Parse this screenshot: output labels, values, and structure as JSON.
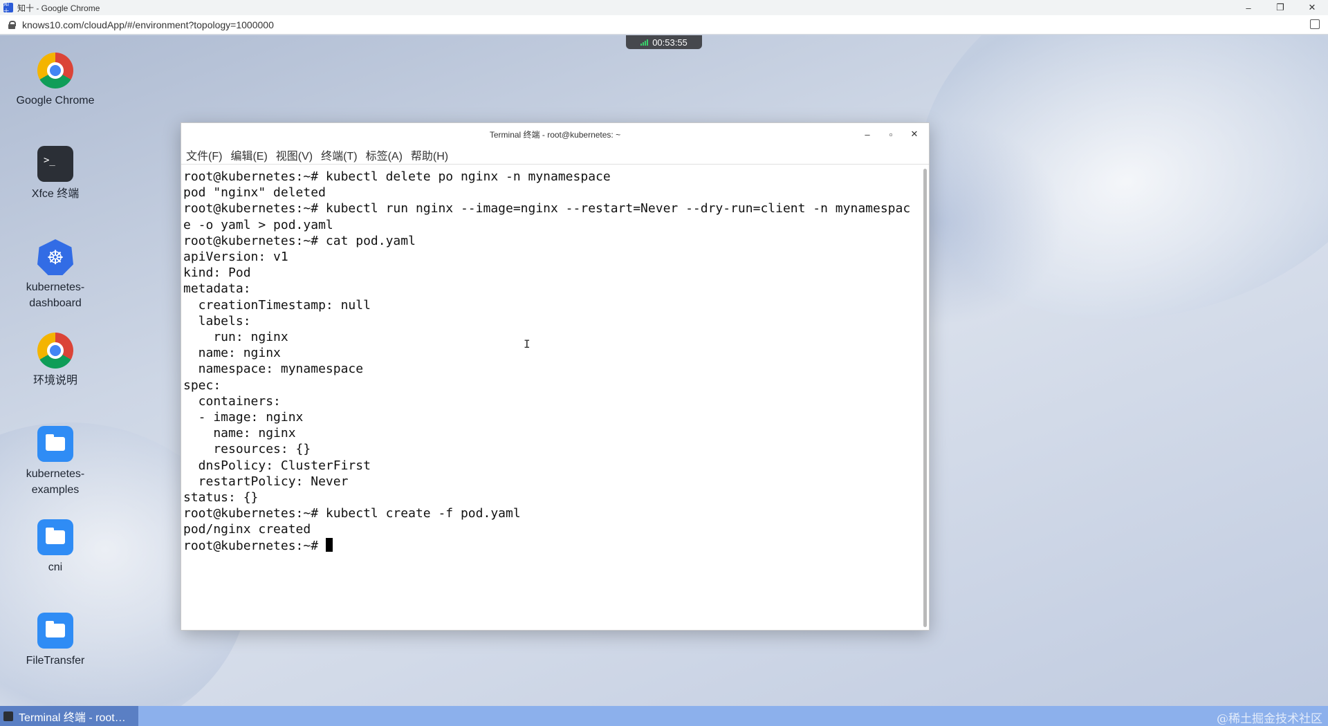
{
  "chrome": {
    "window_title": "知十 - Google Chrome",
    "app_icon": "知十",
    "url": "knows10.com/cloudApp/#/environment?topology=1000000",
    "controls": {
      "minimize": "–",
      "maximize": "❐",
      "close": "✕"
    }
  },
  "desktop": {
    "timer": "00:53:55",
    "icons": [
      {
        "label": "Google Chrome",
        "icon": "chrome-icon"
      },
      {
        "label": "Xfce 终端",
        "icon": "terminal-icon"
      },
      {
        "label": "kubernetes-\ndashboard",
        "icon": "kubernetes-icon"
      },
      {
        "label": "环境说明",
        "icon": "chrome-icon"
      },
      {
        "label": "kubernetes-\nexamples",
        "icon": "folder-icon"
      },
      {
        "label": "cni",
        "icon": "folder-icon"
      },
      {
        "label": "FileTransfer",
        "icon": "folder-icon"
      }
    ]
  },
  "terminal": {
    "title": "Terminal 终端 - root@kubernetes: ~",
    "controls": {
      "minimize": "–",
      "maximize": "▫",
      "close": "✕"
    },
    "menu": [
      "文件(F)",
      "编辑(E)",
      "视图(V)",
      "终端(T)",
      "标签(A)",
      "帮助(H)"
    ],
    "lines": [
      "root@kubernetes:~# kubectl delete po nginx -n mynamespace",
      "pod \"nginx\" deleted",
      "root@kubernetes:~# kubectl run nginx --image=nginx --restart=Never --dry-run=client -n mynamespac",
      "e -o yaml > pod.yaml",
      "root@kubernetes:~# cat pod.yaml",
      "apiVersion: v1",
      "kind: Pod",
      "metadata:",
      "  creationTimestamp: null",
      "  labels:",
      "    run: nginx",
      "  name: nginx",
      "  namespace: mynamespace",
      "spec:",
      "  containers:",
      "  - image: nginx",
      "    name: nginx",
      "    resources: {}",
      "  dnsPolicy: ClusterFirst",
      "  restartPolicy: Never",
      "status: {}",
      "root@kubernetes:~# kubectl create -f pod.yaml",
      "pod/nginx created"
    ],
    "prompt": "root@kubernetes:~# "
  },
  "taskbar": {
    "item_label": "Terminal 终端 - root…",
    "watermark": "@稀土掘金技术社区"
  }
}
